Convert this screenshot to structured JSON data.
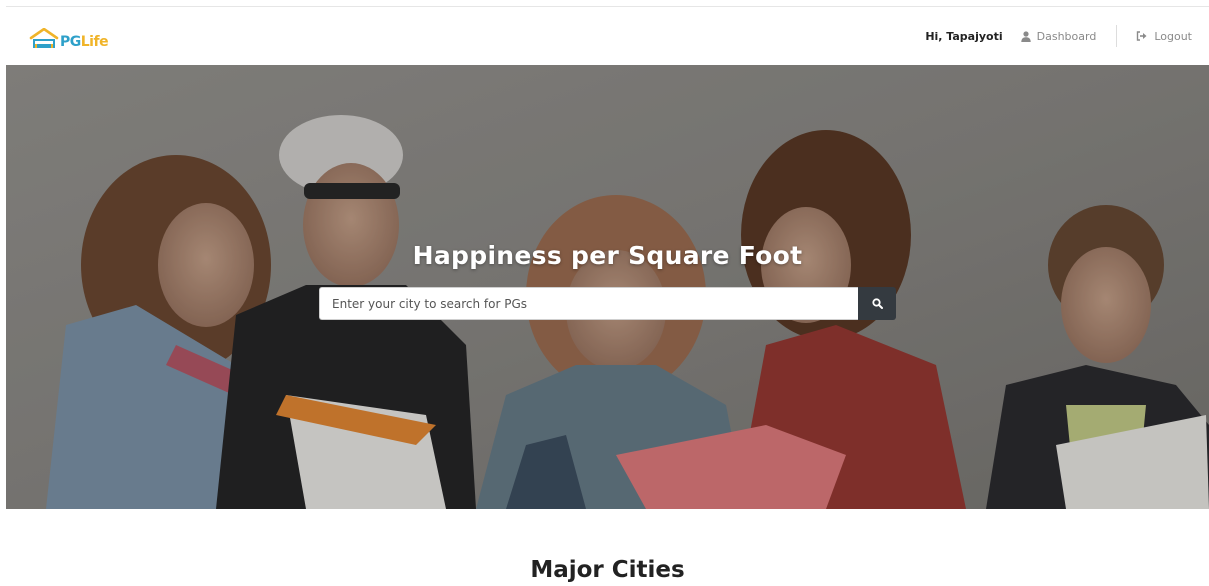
{
  "brand": {
    "name_part1": "PG",
    "name_part2": "Life",
    "logo_icon": "house-logo-icon",
    "colors": {
      "pg": "#2ea0c9",
      "life": "#f0b429"
    }
  },
  "navbar": {
    "greeting": "Hi, Tapajyoti",
    "dashboard_label": "Dashboard",
    "dashboard_icon": "user-icon",
    "logout_label": "Logout",
    "logout_icon": "sign-out-icon"
  },
  "hero": {
    "title": "Happiness per Square Foot",
    "search_placeholder": "Enter your city to search for PGs",
    "search_value": "",
    "search_icon": "search-icon",
    "button_color": "#343a40"
  },
  "sections": {
    "major_cities_heading": "Major Cities"
  }
}
